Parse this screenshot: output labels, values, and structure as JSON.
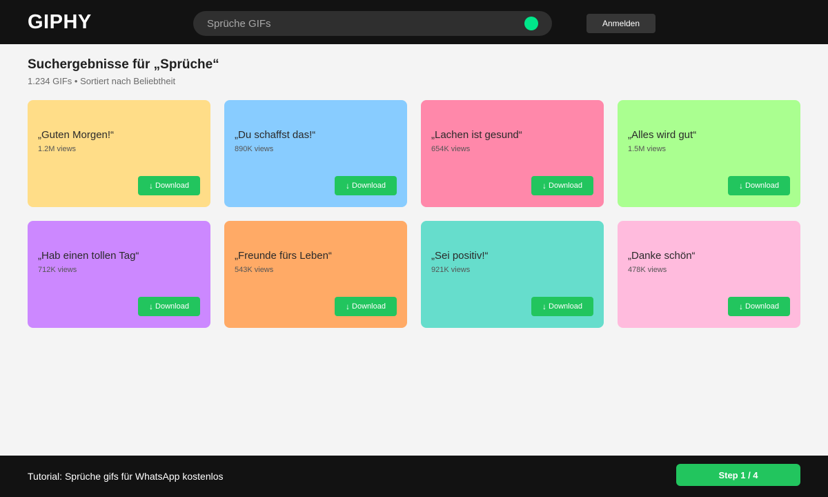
{
  "header": {
    "logo": "GIPHY",
    "search": {
      "value": "",
      "placeholder": "Sprüche GIFs",
      "indicator_color": "#00e68a"
    },
    "login_label": "Anmelden"
  },
  "results": {
    "title": "Suchergebnisse für „Sprüche“",
    "meta": "1.234 GIFs • Sortiert nach Beliebtheit"
  },
  "cards": [
    {
      "title": "„Guten Morgen!“",
      "views": "1.2M views",
      "color": "#ffdd88",
      "download_label": "Download"
    },
    {
      "title": "„Du schaffst das!“",
      "views": "890K views",
      "color": "#88ccff",
      "download_label": "Download"
    },
    {
      "title": "„Lachen ist gesund“",
      "views": "654K views",
      "color": "#ff88aa",
      "download_label": "Download"
    },
    {
      "title": "„Alles wird gut“",
      "views": "1.5M views",
      "color": "#aaff90",
      "download_label": "Download"
    },
    {
      "title": "„Hab einen tollen Tag“",
      "views": "712K views",
      "color": "#cc88ff",
      "download_label": "Download"
    },
    {
      "title": "„Freunde fürs Leben“",
      "views": "543K views",
      "color": "#ffaa66",
      "download_label": "Download"
    },
    {
      "title": "„Sei positiv!“",
      "views": "921K views",
      "color": "#66ddcc",
      "download_label": "Download"
    },
    {
      "title": "„Danke schön“",
      "views": "478K views",
      "color": "#ffbbdd",
      "download_label": "Download"
    }
  ],
  "icons": {
    "download": "download-arrow-icon",
    "download_glyph": "↓"
  },
  "accent_color": "#22c55e",
  "footer": {
    "tutorial_text": "Tutorial: Sprüche gifs für WhatsApp kostenlos",
    "step_label": "Step 1 / 4"
  }
}
